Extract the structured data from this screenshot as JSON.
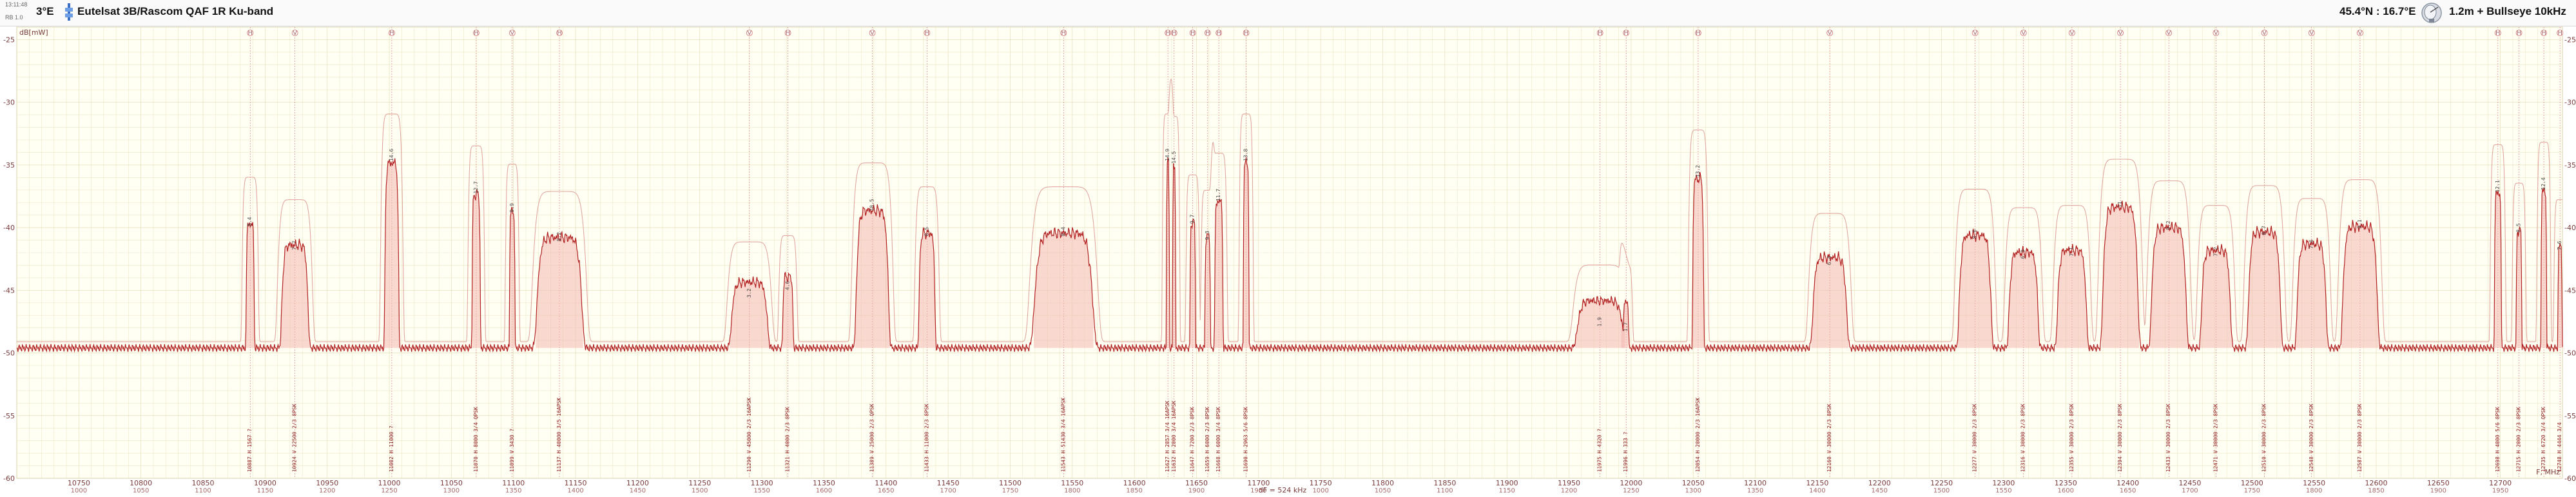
{
  "header": {
    "orbital_position": "3°E",
    "satellite_name": "Eutelsat 3B/Rascom QAF 1R Ku-band",
    "location": "45.4°N : 16.7°E",
    "dish": "1.2m + Bullseye 10kHz",
    "left_small_top": "13:11:48",
    "left_small_bottom": "RB 1.0"
  },
  "colors": {
    "spectrum": "#b22222",
    "fill": "#f4b8b0",
    "envelope": "#e0a8a0",
    "grid": "#ede6c6",
    "marker": "#d07070",
    "background": "#fffff4"
  },
  "chart_data": {
    "type": "line",
    "ylabel": "dB[mW]",
    "xlabel": "F, MHz",
    "xlim": [
      10700,
      12750
    ],
    "ylim": [
      -60,
      -24
    ],
    "noise_floor": -49.6,
    "x_ticks": [
      10750,
      10800,
      10850,
      10900,
      10950,
      11000,
      11050,
      11100,
      11150,
      11200,
      11250,
      11300,
      11350,
      11400,
      11450,
      11500,
      11550,
      11600,
      11650,
      11700,
      11750,
      11800,
      11850,
      11900,
      11950,
      12000,
      12050,
      12100,
      12150,
      12200,
      12250,
      12300,
      12350,
      12400,
      12450,
      12500,
      12550,
      12600,
      12650,
      12700
    ],
    "y_ticks": [
      -25,
      -30,
      -35,
      -40,
      -45,
      -50,
      -55,
      -60
    ],
    "if_ticks": [
      1000,
      1050,
      1100,
      1150,
      1200,
      1250,
      1300,
      1350,
      1400,
      1450,
      1500,
      1550,
      1600,
      1650,
      1700,
      1750,
      1800,
      1850,
      1900,
      1950,
      2000,
      2050,
      2100,
      2150
    ],
    "if_tick_values": [
      1000,
      1050,
      1100,
      1150,
      1200,
      1250,
      1300,
      1350,
      1400,
      1450,
      1500,
      1550,
      1600,
      1650,
      1700,
      1750,
      1800,
      1850,
      1900,
      1950,
      1000,
      1050,
      1100,
      1150,
      1200,
      1250,
      1300,
      1350,
      1400,
      1450,
      1500,
      1550,
      1600,
      1650,
      1700,
      1750,
      1800,
      1850,
      1900,
      1950
    ],
    "span_label": "dF = 524 kHz",
    "channels": [
      {
        "f": 10888,
        "w": 6,
        "top": -40.2,
        "snr": "8.4",
        "label": "10887 H  1567  ?"
      },
      {
        "f": 10924,
        "w": 20,
        "top": -42.1,
        "snr": "7.7",
        "label": "10924 V  22500 2/3  8PSK"
      },
      {
        "f": 11002,
        "w": 10,
        "top": -35.0,
        "snr": "14.6",
        "label": "11002 H  11000  ?"
      },
      {
        "f": 11070,
        "w": 6,
        "top": -37.6,
        "snr": "12.7",
        "label": "11070 H  8000 3/4 QPSK"
      },
      {
        "f": 11099,
        "w": 4,
        "top": -39.1,
        "snr": "9.9",
        "label": "11099 V  3430  ?"
      },
      {
        "f": 11137,
        "w": 34,
        "top": -41.4,
        "snr": "8.2",
        "label": "11137 H  40000 3/5 16APSK"
      },
      {
        "f": 11290,
        "w": 28,
        "top": -45.9,
        "snr": "3.2",
        "label": "11290 V  45000 2/3 16APSK"
      },
      {
        "f": 11321,
        "w": 8,
        "top": -45.3,
        "snr": "4.6",
        "label": "11321 H  4000 2/3 8PSK"
      },
      {
        "f": 11389,
        "w": 24,
        "top": -39.0,
        "snr": "10.5",
        "label": "11389 V  25000 2/3 QPSK"
      },
      {
        "f": 11433,
        "w": 12,
        "top": -41.0,
        "snr": "8.5",
        "label": "11433 H  11000 2/3 8PSK"
      },
      {
        "f": 11543,
        "w": 44,
        "top": -41.0,
        "snr": "8.4",
        "label": "11543 H  51430 3/4 16APSK"
      },
      {
        "f": 11627,
        "w": 2,
        "top": -35.0,
        "snr": "14.9",
        "label": "11627 H  2857 3/4 16APSK"
      },
      {
        "f": 11632,
        "w": 2,
        "top": -35.2,
        "snr": "14.5",
        "label": "11632 H  2000 3/4 16APSK"
      },
      {
        "f": 11647,
        "w": 4,
        "top": -40.0,
        "snr": "9.7",
        "label": "11647 H  7200 2/3 8PSK"
      },
      {
        "f": 11659,
        "w": 4,
        "top": -41.3,
        "snr": "9.3",
        "label": "11659 H  6000 2/3 8PSK"
      },
      {
        "f": 11668,
        "w": 6,
        "top": -38.2,
        "snr": "11.7",
        "label": "11668 H  6000 3/4 8PSK"
      },
      {
        "f": 11690,
        "w": 4,
        "top": -35.0,
        "snr": "13.8",
        "label": "11690 H  2963 5/6 8PSK"
      },
      {
        "f": 11975,
        "w": 36,
        "top": -48.2,
        "snr": "1.9",
        "label": "11975 H  4320  ?"
      },
      {
        "f": 11996,
        "w": 4,
        "top": -48.6,
        "snr": "1.7",
        "label": "11996 H  333  ?"
      },
      {
        "f": 12054,
        "w": 8,
        "top": -36.3,
        "snr": "13.2",
        "label": "12054 H  20000 2/3 16APSK"
      },
      {
        "f": 12160,
        "w": 26,
        "top": -43.3,
        "snr": "6.4",
        "label": "12160 V  30000 2/3 8PSK"
      },
      {
        "f": 12277,
        "w": 24,
        "top": -41.2,
        "snr": "8.6",
        "label": "12277 V  30000 2/3 8PSK"
      },
      {
        "f": 12316,
        "w": 22,
        "top": -42.8,
        "snr": "6.9",
        "label": "12316 V  30000 2/3 8PSK"
      },
      {
        "f": 12355,
        "w": 22,
        "top": -42.6,
        "snr": "7.1",
        "label": "12355 V  30000 2/3 8PSK"
      },
      {
        "f": 12394,
        "w": 26,
        "top": -38.7,
        "snr": "11",
        "label": "12394 V  30000 2/3 8PSK"
      },
      {
        "f": 12433,
        "w": 26,
        "top": -40.5,
        "snr": "9.2",
        "label": "12433 V  30000 2/3 8PSK"
      },
      {
        "f": 12471,
        "w": 22,
        "top": -42.6,
        "snr": "7.2",
        "label": "12471 V  30000 2/3 8PSK"
      },
      {
        "f": 12510,
        "w": 24,
        "top": -40.9,
        "snr": "8.7",
        "label": "12510 V  30000 2/3 8PSK"
      },
      {
        "f": 12548,
        "w": 22,
        "top": -42.0,
        "snr": "7.6",
        "label": "12548 V  30000 2/3 8PSK"
      },
      {
        "f": 12587,
        "w": 26,
        "top": -40.4,
        "snr": "9.1",
        "label": "12587 V  30000 2/3 8PSK"
      },
      {
        "f": 12698,
        "w": 5,
        "top": -37.5,
        "snr": "12.1",
        "label": "12698 H  4000 5/6 8PSK"
      },
      {
        "f": 12715,
        "w": 4,
        "top": -40.7,
        "snr": "8.5",
        "label": "12715 H  2000 2/3 8PSK"
      },
      {
        "f": 12735,
        "w": 4,
        "top": -37.3,
        "snr": "12.4",
        "label": "12735 H  6720 3/4 QPSK"
      },
      {
        "f": 12748,
        "w": 3,
        "top": -42.1,
        "snr": "7.6",
        "label": "12748 H  4444 3/4"
      }
    ]
  }
}
